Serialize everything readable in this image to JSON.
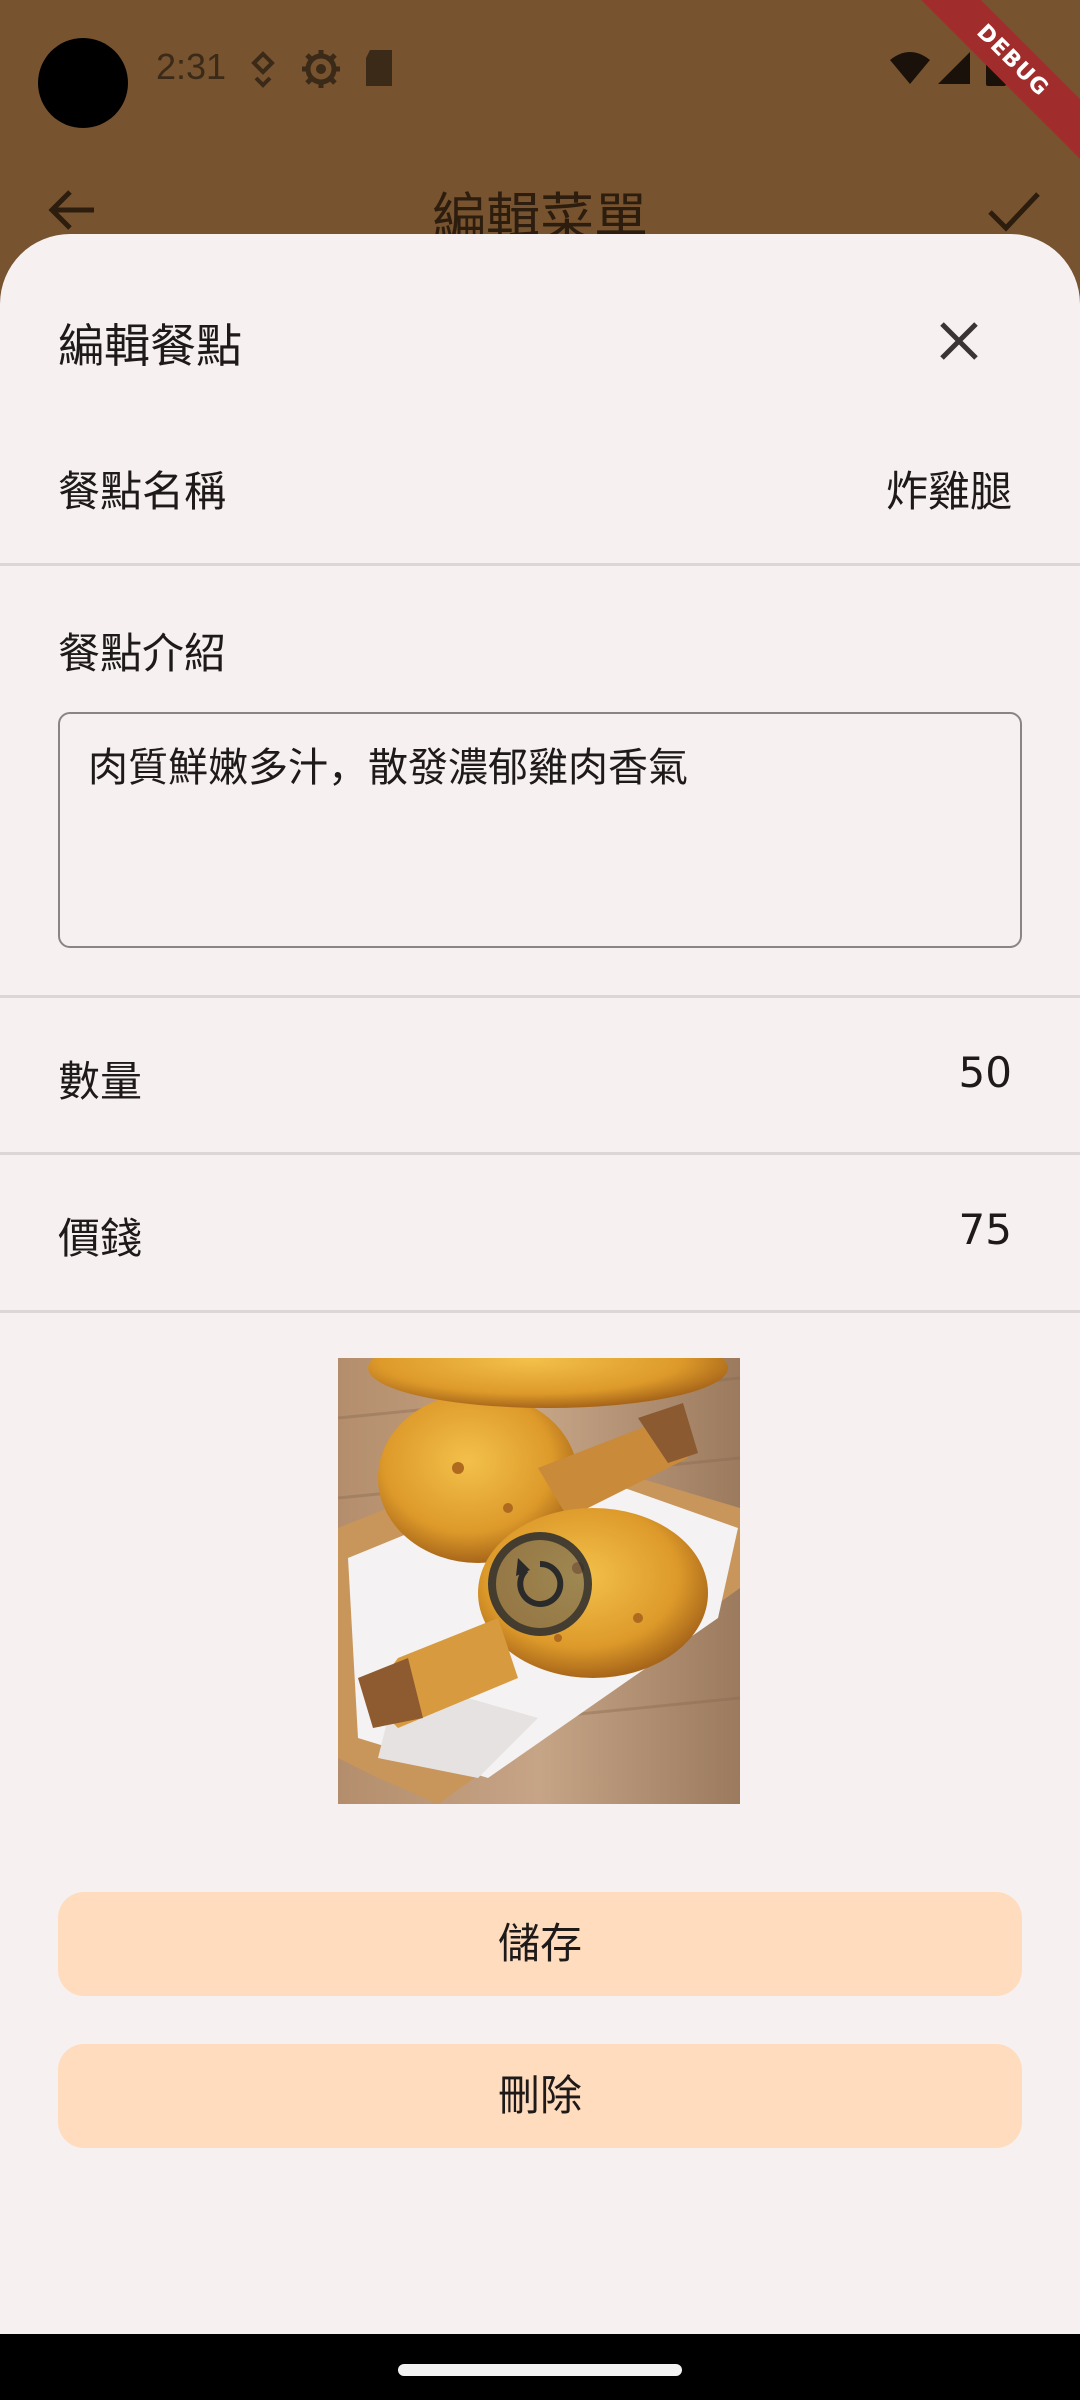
{
  "status_bar": {
    "time": "2:31"
  },
  "debug_banner": "DEBUG",
  "app_bar": {
    "title": "編輯菜單"
  },
  "sheet": {
    "title": "編輯餐點",
    "name_row": {
      "label": "餐點名稱",
      "value": "炸雞腿"
    },
    "description": {
      "label": "餐點介紹",
      "value": "肉質鮮嫩多汁，散發濃郁雞肉香氣"
    },
    "quantity_row": {
      "label": "數量",
      "value": "50"
    },
    "price_row": {
      "label": "價錢",
      "value": "75"
    },
    "save_label": "儲存",
    "delete_label": "刪除"
  },
  "colors": {
    "app_bar_bg": "#77532f",
    "sheet_bg": "#f6f0f0",
    "button_bg": "#ffdcbd",
    "debug_ribbon": "#a02c2c"
  },
  "icons": [
    "back-arrow-icon",
    "check-icon",
    "close-icon",
    "rotate-icon",
    "wifi-icon",
    "signal-icon",
    "battery-icon",
    "settings-icon",
    "sd-card-icon",
    "location-icon"
  ]
}
